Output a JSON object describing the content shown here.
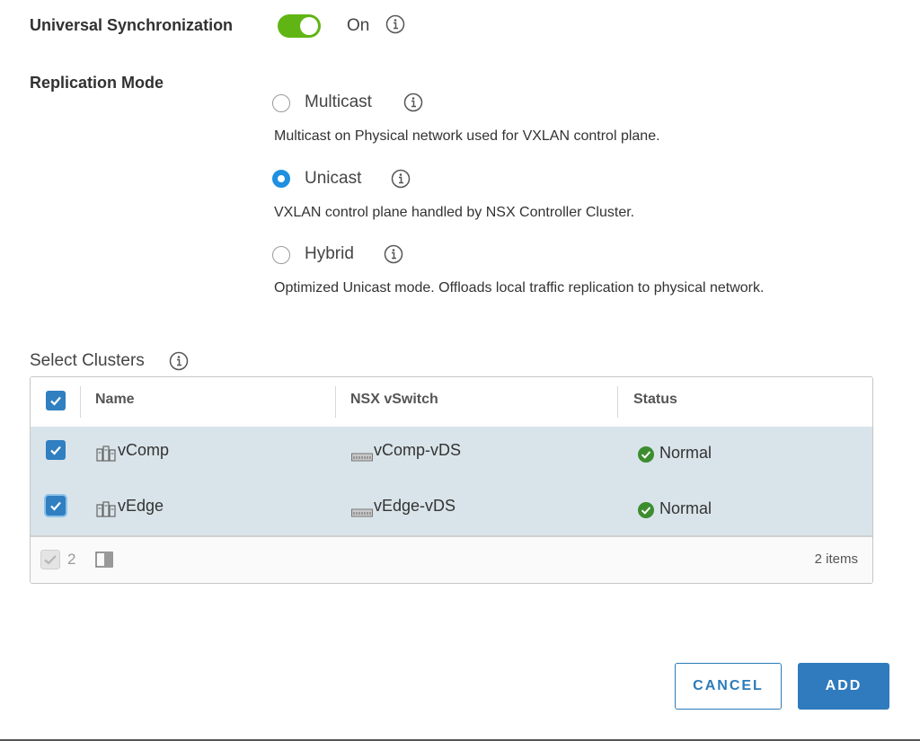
{
  "sync": {
    "label": "Universal Synchronization",
    "state_text": "On",
    "enabled": true
  },
  "replication": {
    "label": "Replication Mode",
    "options": [
      {
        "label": "Multicast",
        "description": "Multicast on Physical network used for VXLAN control plane.",
        "selected": false
      },
      {
        "label": "Unicast",
        "description": "VXLAN control plane handled by NSX Controller Cluster.",
        "selected": true
      },
      {
        "label": "Hybrid",
        "description": "Optimized Unicast mode. Offloads local traffic replication to physical network.",
        "selected": false
      }
    ]
  },
  "clusters": {
    "label": "Select Clusters",
    "columns": [
      "Name",
      "NSX vSwitch",
      "Status"
    ],
    "rows": [
      {
        "name": "vComp",
        "vswitch": "vComp-vDS",
        "status": "Normal",
        "checked": true
      },
      {
        "name": "vEdge",
        "vswitch": "vEdge-vDS",
        "status": "Normal",
        "checked": true
      }
    ],
    "selected_count": "2",
    "items_text": "2 items"
  },
  "actions": {
    "cancel_label": "CANCEL",
    "add_label": "ADD"
  },
  "colors": {
    "toggle_on": "#60b515",
    "radio_selected": "#1f8fe0",
    "primary": "#2f7bbd",
    "row_selected": "#d9e4ea",
    "status_ok": "#3c8d2f"
  }
}
